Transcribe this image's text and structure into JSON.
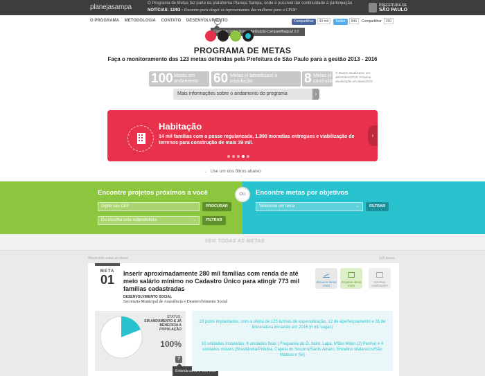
{
  "topbar": {
    "logo_prefix": "",
    "logo": "planejasampa",
    "notice_line1": "O Programa de Metas faz parte da plataforma Planeja Sampa, onde é possível dar continuidade à participação.",
    "notice_label": "NOTÍCIAS:",
    "notice_date": "12/03 -",
    "notice_text": "Encontro para eleger os representantes das mulheres para o CPOP",
    "prefeitura_top": "PREFEITURA DE",
    "prefeitura_city": "SÃO PAULO"
  },
  "nav": {
    "items": [
      "O PROGRAMA",
      "METODOLOGIA",
      "CONTATO",
      "DESENVOLVIMENTO"
    ],
    "cc_label": "cc",
    "tooltip": "Conteúdo sob a licença Atribuição-Compartilhaigual 3.0"
  },
  "share": {
    "facebook": "Compartilhar",
    "facebook_count": "43 mil",
    "twitter": "Twitter",
    "twitter_count": "846",
    "google": "Compartilhar",
    "google_count": "350"
  },
  "header": {
    "title": "PROGRAMA DE METAS",
    "subtitle": "Faça o monitoramento das 123 metas definidas pela Prefeitura de São Paulo para a gestão 2013 - 2016"
  },
  "stats": [
    {
      "num": "100",
      "label": "Metas em andamento"
    },
    {
      "num": "60",
      "label": "Metas já beneficiam a população"
    },
    {
      "num": "8",
      "label": "Metas já concluídas"
    }
  ],
  "stats_note": "© Dados atualizados em dezembro/2015. Próxima atualização em Maio/2016",
  "more_button": "Mais informações sobre o andamento do programa",
  "more_arrow": "›",
  "banner": {
    "title": "Habitação",
    "text": "14 mil famílias com a posse regularizada, 1.890 moradias entregues e viabilização de terrenos para construção de mais 39 mil.",
    "next": "›"
  },
  "filter_hint": "Use um dos filtros abaixo",
  "filters": {
    "left_title": "Encontre projetos próximos a você",
    "cep_placeholder": "Digite seu CEP",
    "procurar": "PROCURAR",
    "subpref": "Ou escolha uma subprefeitura",
    "filtrar": "FILTRAR",
    "ou": "OU",
    "right_title": "Encontre metas por objetivos",
    "tema": "Selecione um tema",
    "filtrar2": "FILTRAR"
  },
  "see_all": "VER TODAS AS METAS",
  "list": {
    "showing": "Mostrando todas as metas",
    "count": "123 metas"
  },
  "meta": {
    "label": "META",
    "number": "01",
    "title": "Inserir aproximadamente 280 mil famílias com renda de até meio salário mínimo no Cadastro Único para atingir 773 mil famílias cadastradas",
    "secretaria_short": "DESENVOLVIMENTO SOCIAL",
    "secretaria": "Secretaria Municipal de Assistência e Desenvolvimento Social",
    "actions": [
      "Resumo desta meta",
      "Projetos desta meta",
      "Receber notificações"
    ],
    "status_head": "STATUS:",
    "status_text": "EM ANDAMENTO E JÁ BENEFICIA A POPULAÇÃO",
    "percent": "100%",
    "progress_fraction": 0.19,
    "help": "?",
    "help_tip": "Entenda como é feito esse cálculo",
    "projects": [
      "18 polos implantados, com a oferta de 125 turmas de especialização, 12 de aperfeiçoamento e 31 de licenciatura iniciando em 2016 (6 mil vagas)",
      "10 unidades instaladas: 6 unidades fixas ( Freguesia do Ó, Itaim, Lapa, M'Boi Mirim (2) Penha) e 4 unidades móveis (Brasilândia/Pirituba, Capela do Socorro/Santo Amaro, Ermelino Matarazzo/São Mateus e Sé)"
    ]
  },
  "colors": {
    "accent_red": "#e8314b",
    "green": "#8cc63f",
    "cyan": "#29c2cf"
  }
}
